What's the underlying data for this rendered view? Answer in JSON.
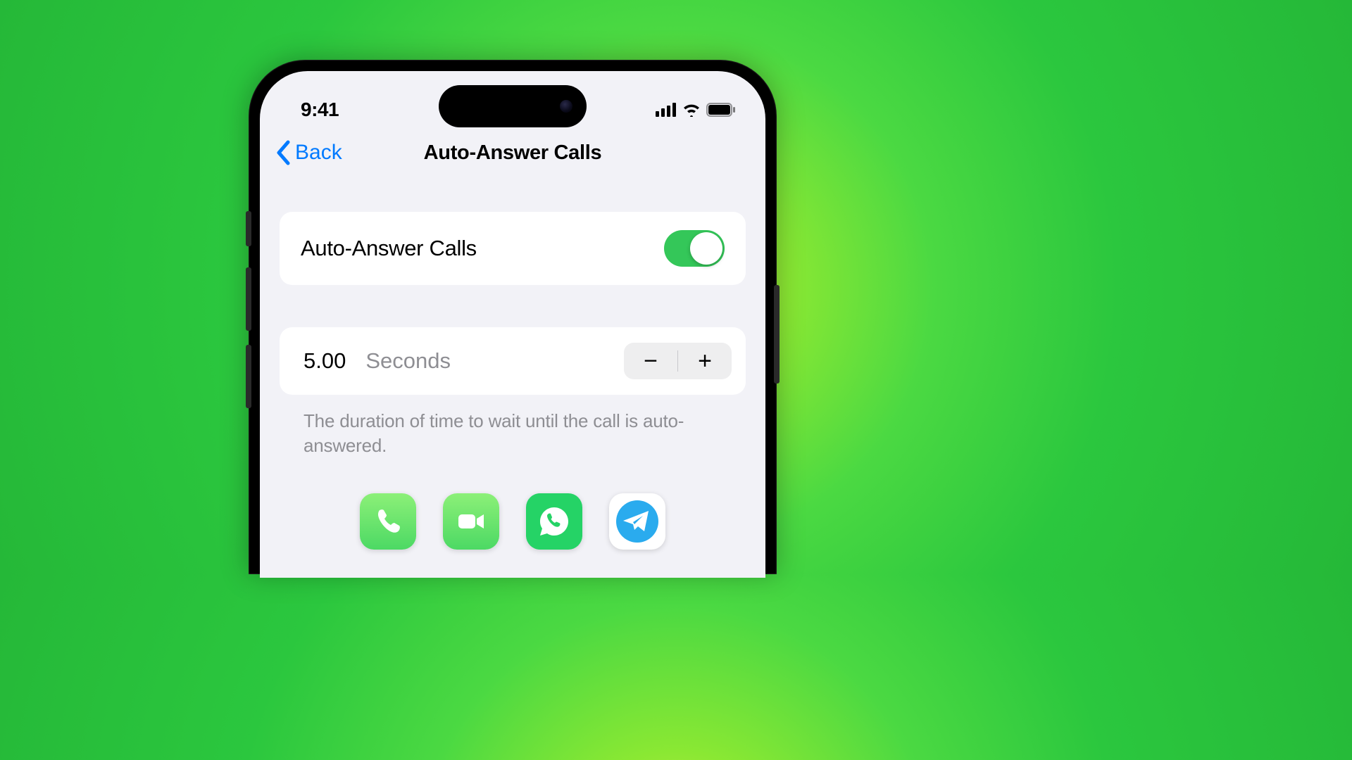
{
  "status": {
    "time": "9:41"
  },
  "nav": {
    "back_label": "Back",
    "title": "Auto-Answer Calls"
  },
  "settings": {
    "toggle_label": "Auto-Answer Calls",
    "toggle_on": true
  },
  "duration": {
    "value": "5.00",
    "unit": "Seconds",
    "minus": "−",
    "plus": "+",
    "footer": "The duration of time to wait until the call is auto-answered."
  },
  "apps": [
    {
      "name": "phone"
    },
    {
      "name": "facetime"
    },
    {
      "name": "whatsapp"
    },
    {
      "name": "telegram"
    }
  ]
}
